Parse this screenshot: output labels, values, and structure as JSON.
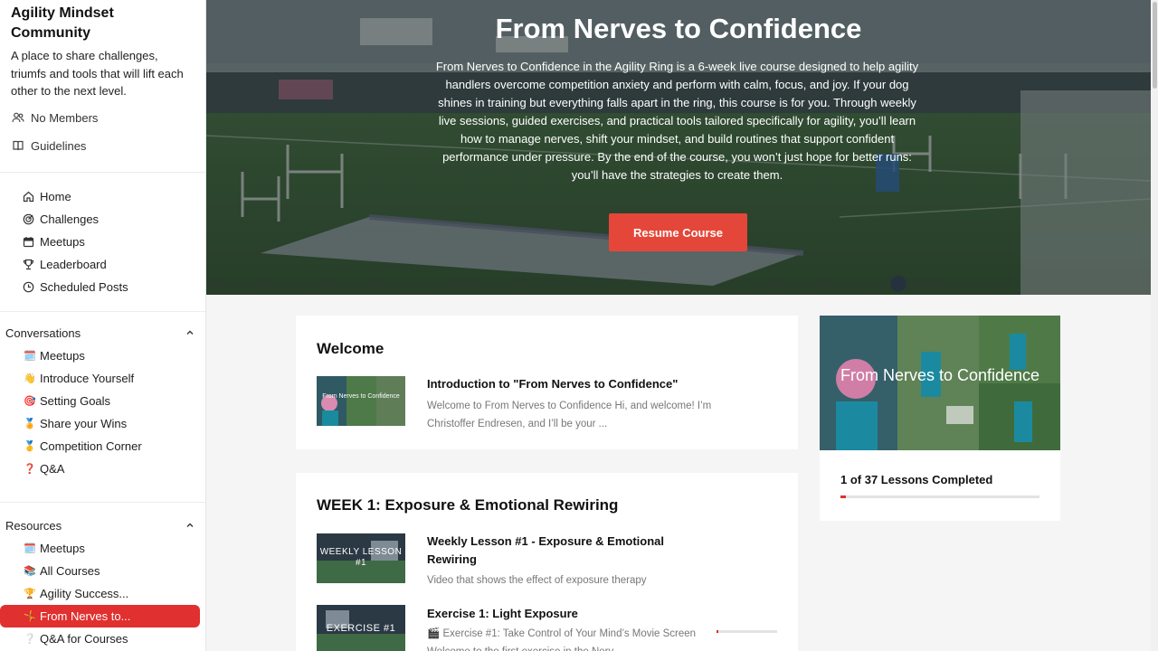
{
  "community": {
    "title": "Agility Mindset Community",
    "description": "A place to share challenges, triumfs and tools that will lift each other to the next level.",
    "members_label": "No Members",
    "guidelines_label": "Guidelines"
  },
  "nav": [
    {
      "label": "Home",
      "icon": "home-icon"
    },
    {
      "label": "Challenges",
      "icon": "target-icon"
    },
    {
      "label": "Meetups",
      "icon": "calendar-icon"
    },
    {
      "label": "Leaderboard",
      "icon": "trophy-icon"
    },
    {
      "label": "Scheduled Posts",
      "icon": "clock-icon"
    }
  ],
  "conversations": {
    "heading": "Conversations",
    "items": [
      {
        "emoji": "🗓️",
        "label": "Meetups"
      },
      {
        "emoji": "👋",
        "label": "Introduce Yourself"
      },
      {
        "emoji": "🎯",
        "label": "Setting Goals"
      },
      {
        "emoji": "🏅",
        "label": "Share your Wins"
      },
      {
        "emoji": "🥇",
        "label": "Competition Corner"
      },
      {
        "emoji": "❓",
        "label": "Q&A"
      }
    ]
  },
  "resources": {
    "heading": "Resources",
    "items": [
      {
        "emoji": "🗓️",
        "label": "Meetups"
      },
      {
        "emoji": "📚",
        "label": "All Courses"
      },
      {
        "emoji": "🏆",
        "label": "Agility Success..."
      },
      {
        "emoji": "🤸",
        "label": "From Nerves to...",
        "active": true
      },
      {
        "emoji": "❔",
        "label": "Q&A for Courses"
      }
    ]
  },
  "hero": {
    "title": "From Nerves to Confidence",
    "description": "From Nerves to Confidence in the Agility Ring is a 6-week live course designed to help agility handlers overcome competition anxiety and perform with calm, focus, and joy. If your dog shines in training but everything falls apart in the ring, this course is for you. Through weekly live sessions, guided exercises, and practical tools tailored specifically for agility, you’ll learn how to manage nerves, shift your mindset, and build routines that support confident performance under pressure. By the end of the course, you won’t just hope for better runs: you’ll have the strategies to create them.",
    "button_label": "Resume Course"
  },
  "welcome": {
    "heading": "Welcome",
    "lesson": {
      "title": "Introduction to \"From Nerves to Confidence\"",
      "desc": "Welcome to From Nerves to Confidence Hi, and welcome! I’m Christoffer Endresen, and I’ll be your ...",
      "thumb_text": "From Nerves to Confidence"
    }
  },
  "week1": {
    "heading": "WEEK 1: Exposure & Emotional Rewiring",
    "lessons": [
      {
        "title": "Weekly Lesson #1 - Exposure & Emotional Rewiring",
        "desc": "Video that shows the effect of exposure therapy",
        "thumb_text": "WEEKLY LESSON #1"
      },
      {
        "title": "Exercise 1: Light Exposure",
        "desc": "🎬 Exercise #1: Take Control of Your Mind’s Movie Screen Welcome to the first exercise in the Nerv...",
        "thumb_text": "EXERCISE #1",
        "progress": 0.03
      }
    ]
  },
  "course_card": {
    "image_title": "From Nerves to Confidence",
    "progress_label": "1 of 37 Lessons Completed",
    "progress": 0.027
  },
  "colors": {
    "accent": "#e0302f",
    "button": "#e4473a"
  }
}
